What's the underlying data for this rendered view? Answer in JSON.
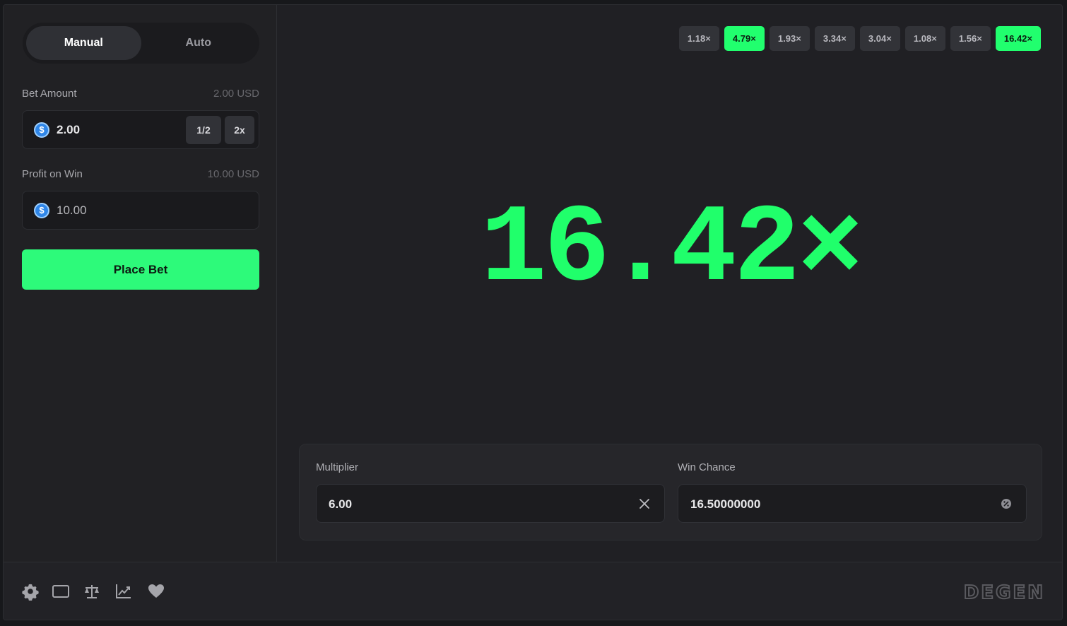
{
  "mode_tabs": [
    {
      "label": "Manual",
      "active": true
    },
    {
      "label": "Auto",
      "active": false
    }
  ],
  "bet": {
    "label": "Bet Amount",
    "usd_value": "2.00 USD",
    "value": "2.00",
    "half_label": "1/2",
    "double_label": "2x",
    "coin_icon": "usd-coin-icon"
  },
  "profit": {
    "label": "Profit on Win",
    "usd_value": "10.00 USD",
    "value": "10.00"
  },
  "place_bet_label": "Place Bet",
  "history": [
    "1.18×",
    "4.79×",
    "1.93×",
    "3.34×",
    "3.04×",
    "1.08×",
    "1.56×",
    "16.42×"
  ],
  "history_win": [
    false,
    true,
    false,
    false,
    false,
    false,
    false,
    true
  ],
  "result": "16.42×",
  "controls": {
    "multiplier_label": "Multiplier",
    "multiplier_value": "6.00",
    "multiplier_icon": "close-icon",
    "win_chance_label": "Win Chance",
    "win_chance_value": "16.50000000",
    "win_chance_icon": "percent-icon"
  },
  "footer": {
    "icons": [
      "gear-icon",
      "window-icon",
      "balance-scale-icon",
      "chart-icon",
      "heart-icon"
    ],
    "brand": "DEGEN"
  },
  "colors": {
    "accent_green": "#20ff6b",
    "panel": "#212124",
    "background": "#17181b"
  }
}
